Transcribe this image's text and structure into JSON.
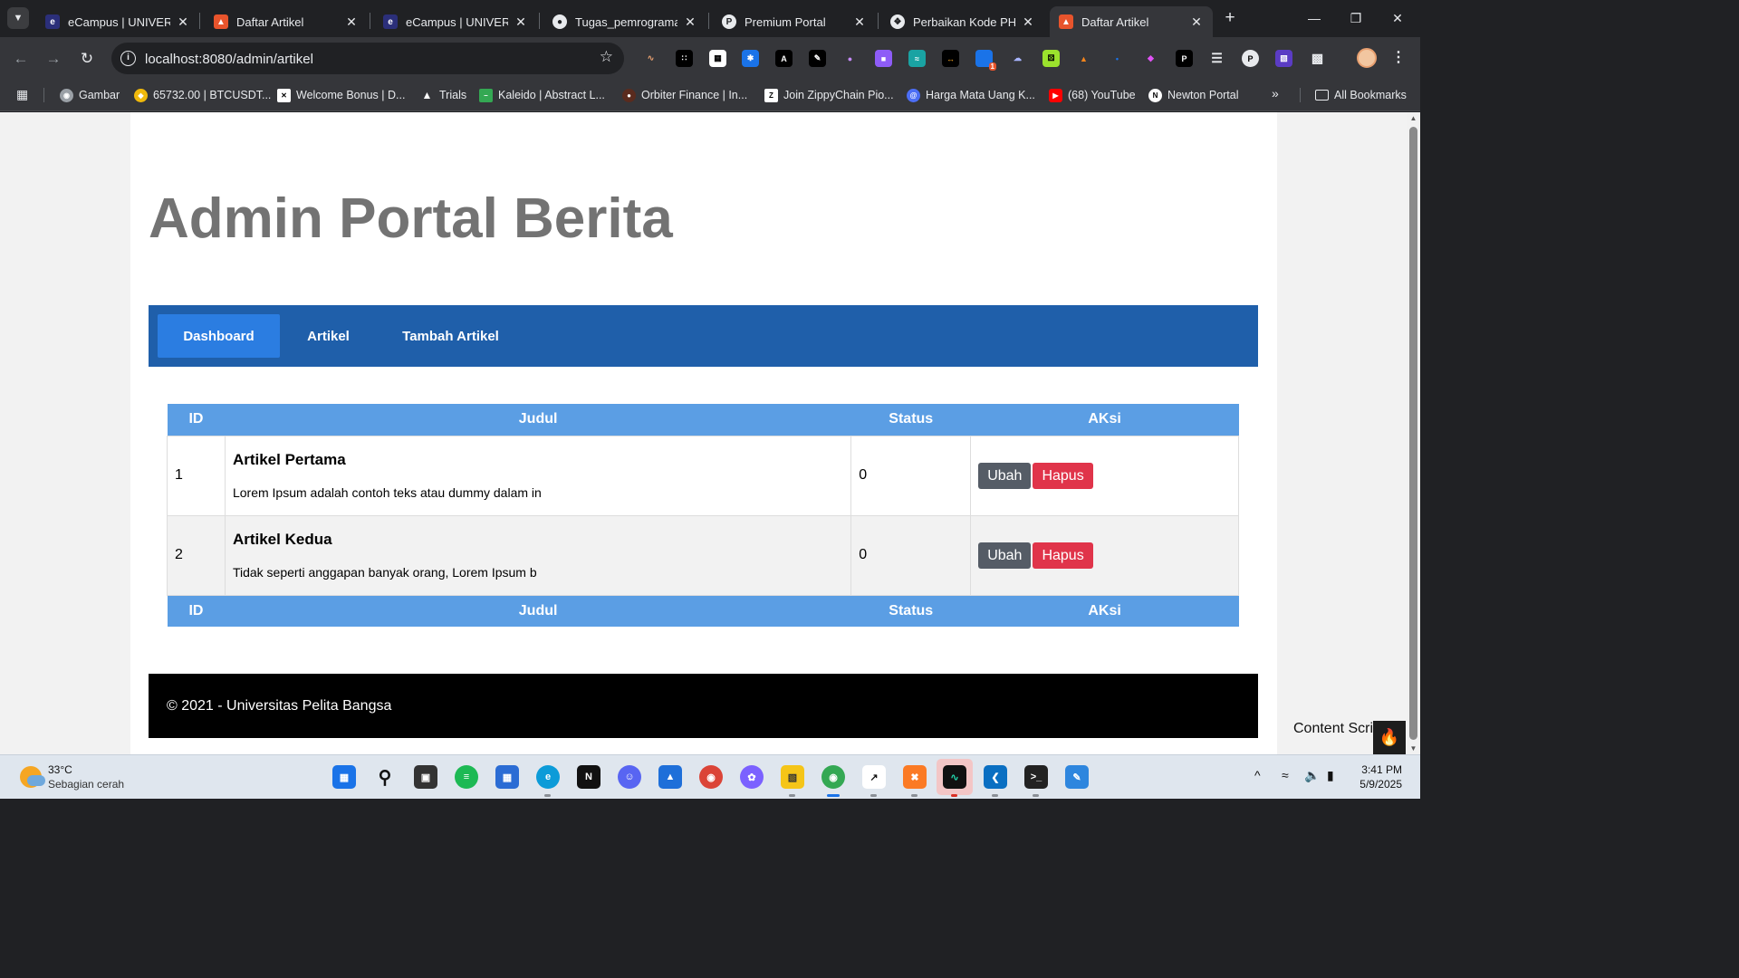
{
  "browser": {
    "tabs": [
      {
        "title": "eCampus | UNIVERSITAS",
        "active": false
      },
      {
        "title": "Daftar Artikel",
        "active": false
      },
      {
        "title": "eCampus | UNIVERSITAS",
        "active": false
      },
      {
        "title": "Tugas_pemrograman",
        "active": false
      },
      {
        "title": "Premium Portal",
        "active": false
      },
      {
        "title": "Perbaikan Kode PHP",
        "active": false
      },
      {
        "title": "Daftar Artikel",
        "active": true
      }
    ],
    "address": "localhost:8080/admin/artikel",
    "bookmarks": [
      "Gambar",
      "65732.00 | BTCUSDT...",
      "Welcome Bonus | D...",
      "Trials",
      "Kaleido | Abstract L...",
      "Orbiter Finance | In...",
      "Join ZippyChain Pio...",
      "Harga Mata Uang K...",
      "(68) YouTube",
      "Newton Portal"
    ],
    "all_bookmarks": "All Bookmarks",
    "ext_badge": "1"
  },
  "page": {
    "title": "Admin Portal Berita",
    "nav": [
      {
        "label": "Dashboard",
        "active": true
      },
      {
        "label": "Artikel",
        "active": false
      },
      {
        "label": "Tambah Artikel",
        "active": false
      }
    ],
    "table": {
      "headers": [
        "ID",
        "Judul",
        "Status",
        "AKsi"
      ],
      "rows": [
        {
          "id": "1",
          "title": "Artikel Pertama",
          "excerpt": "Lorem Ipsum adalah contoh teks atau dummy dalam in",
          "status": "0"
        },
        {
          "id": "2",
          "title": "Artikel Kedua",
          "excerpt": "Tidak seperti anggapan banyak orang, Lorem Ipsum b",
          "status": "0"
        }
      ],
      "edit_label": "Ubah",
      "delete_label": "Hapus"
    },
    "footer": "© 2021 - Universitas Pelita Bangsa",
    "floating_label": "Content Scri"
  },
  "taskbar": {
    "weather_temp": "33°C",
    "weather_desc": "Sebagian cerah",
    "time": "3:41 PM",
    "date": "5/9/2025"
  },
  "colors": {
    "navbar": "#1f5faa",
    "nav_active": "#2b7de1",
    "table_header": "#5b9ee4",
    "btn_edit": "#555c66",
    "btn_delete": "#e0344a",
    "footer": "#000000",
    "title": "#737373"
  }
}
